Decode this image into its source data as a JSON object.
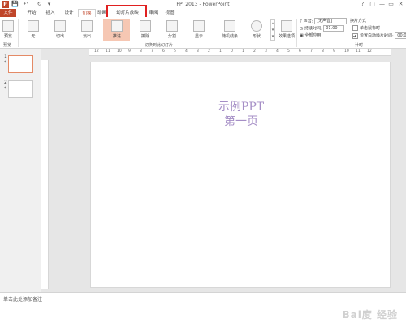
{
  "window": {
    "title": "PPT2013 - PowerPoint",
    "controls": [
      "?",
      "▢",
      "—",
      "▭",
      "✕"
    ]
  },
  "qat": {
    "app_icon": "P",
    "save": "💾",
    "undo": "↶",
    "redo": "↻",
    "customize": "▾"
  },
  "tabs": [
    "文件",
    "开始",
    "插入",
    "设计",
    "切换",
    "动画",
    "幻灯片放映",
    "审阅",
    "视图"
  ],
  "active_tab": "切换",
  "highlighted_tab": "幻灯片放映",
  "ribbon": {
    "preview": {
      "label": "预览",
      "group": "预览"
    },
    "transitions": [
      {
        "label": "无"
      },
      {
        "label": "切出"
      },
      {
        "label": "淡出"
      },
      {
        "label": "推进",
        "selected": true
      },
      {
        "label": "擦除"
      },
      {
        "label": "分割"
      },
      {
        "label": "显示"
      },
      {
        "label": "随机线条"
      },
      {
        "label": "形状"
      }
    ],
    "transitions_group": "切换到此幻灯片",
    "effect_options": "效果选项",
    "timing": {
      "sound_label": "声音:",
      "sound_value": "[无声音]",
      "duration_label": "持续时间:",
      "duration_value": "01.00",
      "apply_all": "全部应用",
      "advance_label": "换片方式",
      "on_click": "单击鼠标时",
      "after_label": "设置自动换片时间:",
      "after_value": "00:0",
      "group": "计时"
    }
  },
  "slides": [
    {
      "number": "1",
      "star": "*"
    },
    {
      "number": "2",
      "star": "*"
    }
  ],
  "ruler_ticks": [
    "12",
    "11",
    "10",
    "9",
    "8",
    "7",
    "6",
    "5",
    "4",
    "3",
    "2",
    "1",
    "0",
    "1",
    "2",
    "3",
    "4",
    "5",
    "6",
    "7",
    "8",
    "9",
    "10",
    "11",
    "12"
  ],
  "slide": {
    "line1": "示例PPT",
    "line2": "第一页"
  },
  "notes": {
    "placeholder": "单击此处添加备注"
  },
  "watermark": "Bai度 经验"
}
